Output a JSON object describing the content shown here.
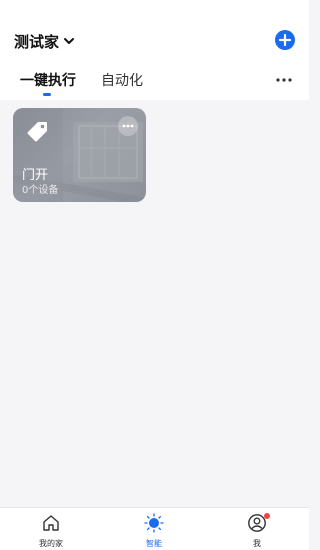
{
  "header": {
    "home_name": "测试家",
    "add_icon": "plus-circle-icon"
  },
  "tabs": [
    {
      "label": "一键执行",
      "active": true
    },
    {
      "label": "自动化",
      "active": false
    }
  ],
  "scenes": [
    {
      "title": "门开",
      "device_count": "0个设备",
      "icon": "tag-icon"
    }
  ],
  "bottom_nav": [
    {
      "label": "我的家",
      "icon": "home-icon",
      "active": false
    },
    {
      "label": "智能",
      "icon": "sun-icon",
      "active": true
    },
    {
      "label": "我",
      "icon": "user-icon",
      "active": false,
      "badge": true
    }
  ],
  "colors": {
    "accent": "#1a6bf0",
    "badge": "#f04444"
  }
}
